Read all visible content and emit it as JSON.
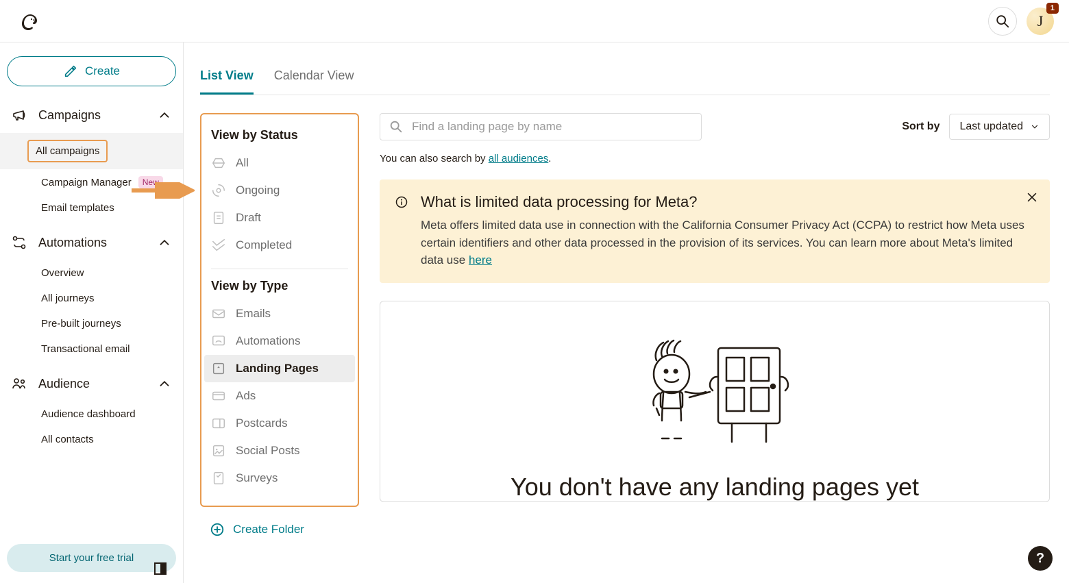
{
  "header": {
    "avatar_letter": "J",
    "avatar_badge": "1"
  },
  "sidebar": {
    "create_label": "Create",
    "trial_cta": "Start your free trial",
    "sections": {
      "campaigns": {
        "label": "Campaigns",
        "items": [
          {
            "label": "All campaigns",
            "active": true
          },
          {
            "label": "Campaign Manager",
            "badge": "New"
          },
          {
            "label": "Email templates"
          }
        ]
      },
      "automations": {
        "label": "Automations",
        "items": [
          {
            "label": "Overview"
          },
          {
            "label": "All journeys"
          },
          {
            "label": "Pre-built journeys"
          },
          {
            "label": "Transactional email"
          }
        ]
      },
      "audience": {
        "label": "Audience",
        "items": [
          {
            "label": "Audience dashboard"
          },
          {
            "label": "All contacts"
          }
        ]
      }
    }
  },
  "tabs": {
    "list": "List View",
    "calendar": "Calendar View"
  },
  "filters": {
    "status_heading": "View by Status",
    "type_heading": "View by Type",
    "status": [
      "All",
      "Ongoing",
      "Draft",
      "Completed"
    ],
    "type": [
      "Emails",
      "Automations",
      "Landing Pages",
      "Ads",
      "Postcards",
      "Social Posts",
      "Surveys"
    ],
    "selected_type": "Landing Pages",
    "create_folder": "Create Folder"
  },
  "search": {
    "placeholder": "Find a landing page by name",
    "sub_text_prefix": "You can also search by ",
    "sub_text_link": "all audiences",
    "sub_text_suffix": "."
  },
  "sort": {
    "label": "Sort by",
    "value": "Last updated"
  },
  "banner": {
    "title": "What is limited data processing for Meta?",
    "body": "Meta offers limited data use in connection with the California Consumer Privacy Act (CCPA) to restrict how Meta uses certain identifiers and other data processed in the provision of its services. You can learn more about Meta's limited data use ",
    "link": "here"
  },
  "empty_state": {
    "title": "You don't have any landing pages yet"
  }
}
